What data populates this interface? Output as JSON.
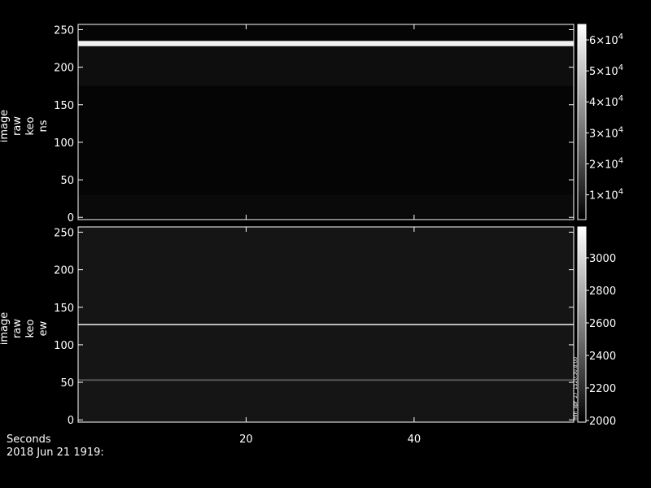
{
  "chart_data": [
    {
      "type": "heatmap",
      "ylabel": "image raw keo ns",
      "ylabel_lines": [
        "image",
        "raw",
        "keo",
        "ns"
      ],
      "ylim": [
        -3,
        257
      ],
      "yticks": [
        0,
        50,
        100,
        150,
        200,
        250
      ],
      "xlim": [
        0,
        59
      ],
      "xticks": [
        20,
        40
      ],
      "background": "#050505",
      "bands": [
        {
          "y0": 226,
          "y1": 235,
          "level": 62000,
          "color": "#f2f2f2"
        },
        {
          "y0": 175,
          "y1": 228,
          "level": 3200,
          "color": "#0e0e0e"
        },
        {
          "y0": 0,
          "y1": 30,
          "level": 2600,
          "color": "#0a0a0a"
        }
      ],
      "colorbar": {
        "range": [
          2000,
          65000
        ],
        "tick_values": [
          10000,
          20000,
          30000,
          40000,
          50000,
          60000
        ],
        "tick_labels": [
          {
            "mantissa": "1×10",
            "exp": "4"
          },
          {
            "mantissa": "2×10",
            "exp": "4"
          },
          {
            "mantissa": "3×10",
            "exp": "4"
          },
          {
            "mantissa": "4×10",
            "exp": "4"
          },
          {
            "mantissa": "5×10",
            "exp": "4"
          },
          {
            "mantissa": "6×10",
            "exp": "4"
          }
        ]
      }
    },
    {
      "type": "heatmap",
      "ylabel": "image raw keo ew",
      "ylabel_lines": [
        "image",
        "raw",
        "keo",
        "ew"
      ],
      "ylim": [
        -3,
        257
      ],
      "yticks": [
        0,
        50,
        100,
        150,
        200,
        250
      ],
      "xlim": [
        0,
        59
      ],
      "xticks": [
        20,
        40
      ],
      "background": "#151515",
      "bands": [
        {
          "y0": 126,
          "y1": 128,
          "level": 3150,
          "color": "#c8c8c8"
        },
        {
          "y0": 52,
          "y1": 54,
          "level": 2400,
          "color": "#5a5a5a"
        }
      ],
      "colorbar": {
        "range": [
          1990,
          3190
        ],
        "tick_values": [
          2000,
          2200,
          2400,
          2600,
          2800,
          3000
        ],
        "tick_labels": [
          "2000",
          "2200",
          "2400",
          "2600",
          "2800",
          "3000"
        ]
      },
      "side_note": "min_apr_27_1520:30.8:00"
    }
  ],
  "footer": {
    "xlabel": "Seconds",
    "date": "2018 Jun 21 1919:"
  },
  "colors": {
    "axes": "#ffffff",
    "background": "#000000",
    "colorbar_top": "#ffffff",
    "colorbar_bottom": "#000000"
  }
}
